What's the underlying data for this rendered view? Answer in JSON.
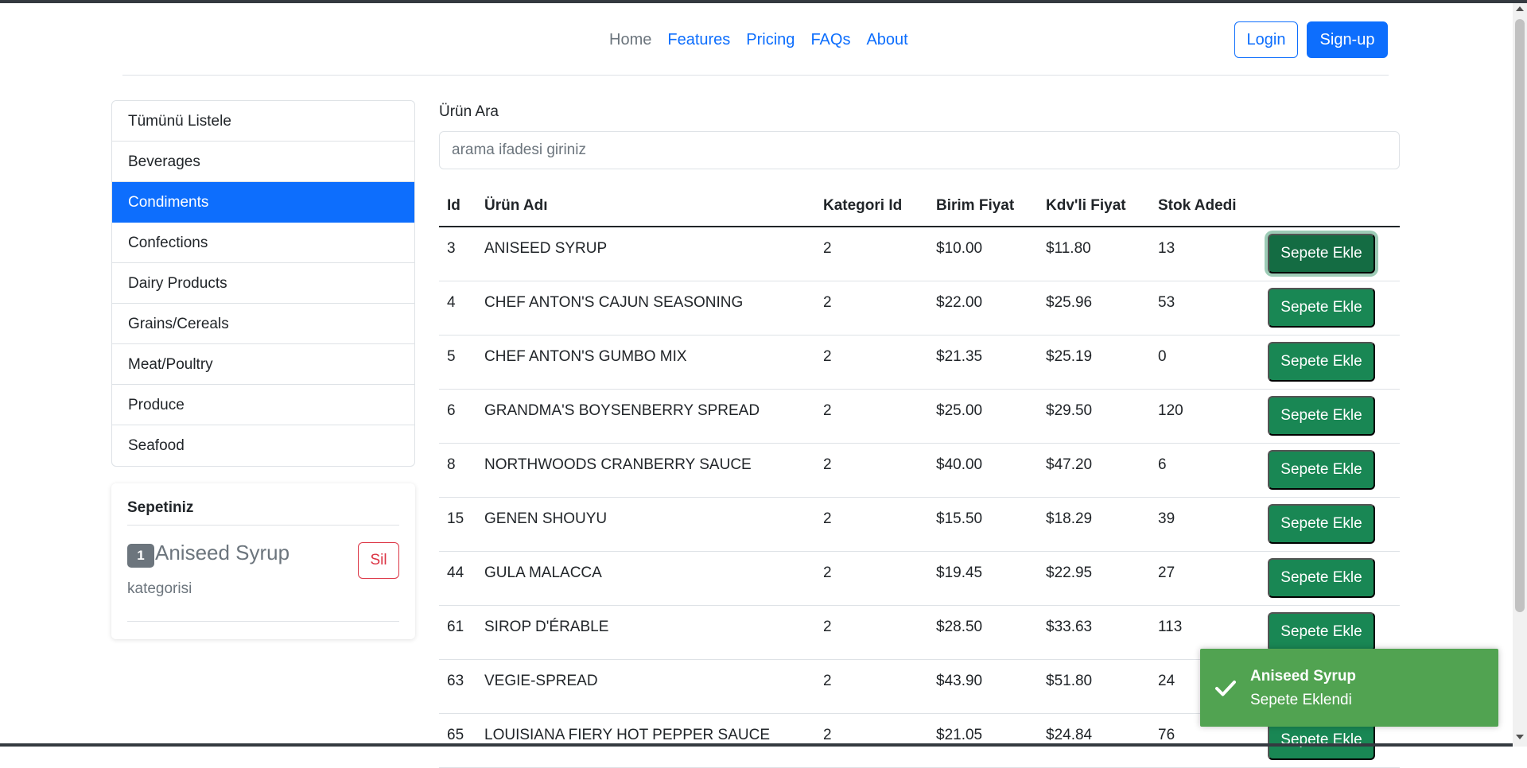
{
  "nav": {
    "links": [
      "Home",
      "Features",
      "Pricing",
      "FAQs",
      "About"
    ],
    "login": "Login",
    "signup": "Sign-up"
  },
  "sidebar": {
    "categories": [
      "Tümünü Listele",
      "Beverages",
      "Condiments",
      "Confections",
      "Dairy Products",
      "Grains/Cereals",
      "Meat/Poultry",
      "Produce",
      "Seafood"
    ],
    "active": "Condiments"
  },
  "cart": {
    "title": "Sepetiniz",
    "count": "1",
    "item_name": "Aniseed Syrup",
    "item_sub": "kategorisi",
    "remove_label": "Sil"
  },
  "search": {
    "label": "Ürün Ara",
    "placeholder": "arama ifadesi giriniz"
  },
  "table": {
    "headers": [
      "Id",
      "Ürün Adı",
      "Kategori Id",
      "Birim Fiyat",
      "Kdv'li Fiyat",
      "Stok Adedi"
    ],
    "add_label": "Sepete Ekle",
    "rows": [
      {
        "id": "3",
        "name": "ANISEED SYRUP",
        "cat": "2",
        "price": "$10.00",
        "kdv": "$11.80",
        "stock": "13"
      },
      {
        "id": "4",
        "name": "CHEF ANTON'S CAJUN SEASONING",
        "cat": "2",
        "price": "$22.00",
        "kdv": "$25.96",
        "stock": "53"
      },
      {
        "id": "5",
        "name": "CHEF ANTON'S GUMBO MIX",
        "cat": "2",
        "price": "$21.35",
        "kdv": "$25.19",
        "stock": "0"
      },
      {
        "id": "6",
        "name": "GRANDMA'S BOYSENBERRY SPREAD",
        "cat": "2",
        "price": "$25.00",
        "kdv": "$29.50",
        "stock": "120"
      },
      {
        "id": "8",
        "name": "NORTHWOODS CRANBERRY SAUCE",
        "cat": "2",
        "price": "$40.00",
        "kdv": "$47.20",
        "stock": "6"
      },
      {
        "id": "15",
        "name": "GENEN SHOUYU",
        "cat": "2",
        "price": "$15.50",
        "kdv": "$18.29",
        "stock": "39"
      },
      {
        "id": "44",
        "name": "GULA MALACCA",
        "cat": "2",
        "price": "$19.45",
        "kdv": "$22.95",
        "stock": "27"
      },
      {
        "id": "61",
        "name": "SIROP D'ÉRABLE",
        "cat": "2",
        "price": "$28.50",
        "kdv": "$33.63",
        "stock": "113"
      },
      {
        "id": "63",
        "name": "VEGIE-SPREAD",
        "cat": "2",
        "price": "$43.90",
        "kdv": "$51.80",
        "stock": "24"
      },
      {
        "id": "65",
        "name": "LOUISIANA FIERY HOT PEPPER SAUCE",
        "cat": "2",
        "price": "$21.05",
        "kdv": "$24.84",
        "stock": "76"
      }
    ]
  },
  "toast": {
    "title": "Aniseed Syrup",
    "message": "Sepete Eklendi",
    "icon": "check-icon",
    "color": "#51a351"
  },
  "colors": {
    "primary": "#0d6efd",
    "success": "#198754",
    "danger": "#dc3545"
  }
}
